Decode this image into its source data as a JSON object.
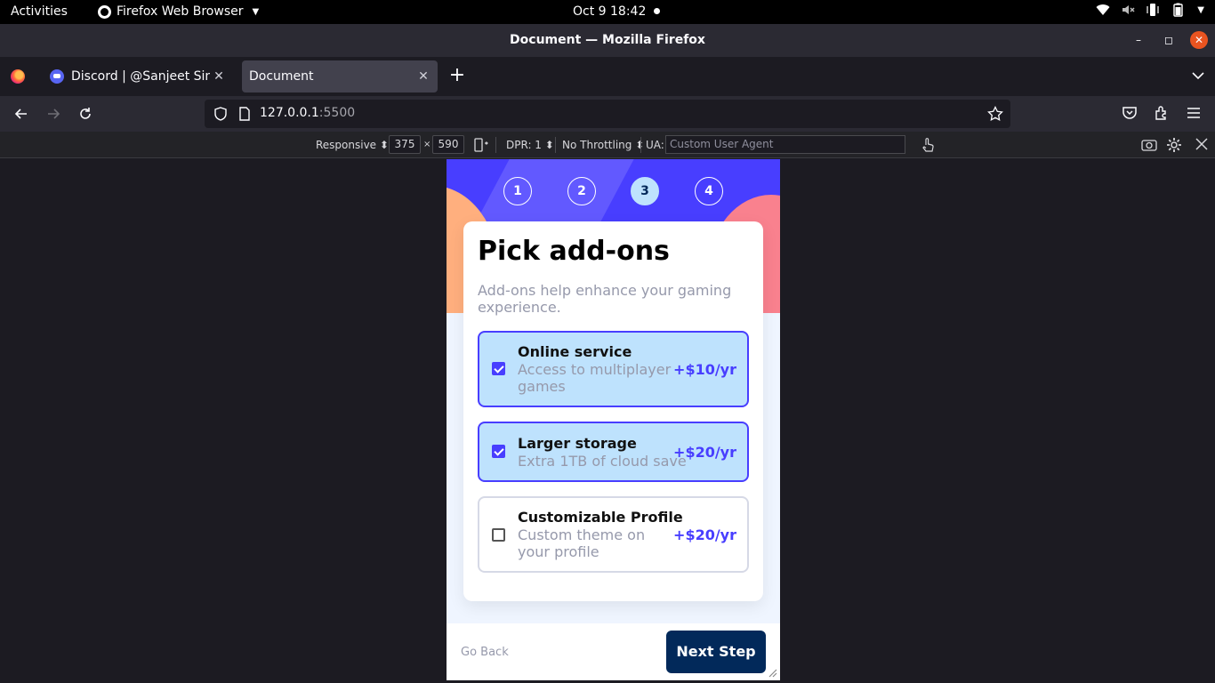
{
  "system": {
    "activities": "Activities",
    "app_name": "Firefox Web Browser",
    "clock": "Oct 9  18:42"
  },
  "window": {
    "title": "Document — Mozilla Firefox"
  },
  "tabs": [
    {
      "label": "Discord | @Sanjeet Singh",
      "active": false
    },
    {
      "label": "Document",
      "active": true
    }
  ],
  "navbar": {
    "url_host": "127.0.0.1",
    "url_port": ":5500"
  },
  "rdm": {
    "device": "Responsive",
    "width": "375",
    "times": "×",
    "height": "590",
    "dpr": "DPR: 1",
    "throttling": "No Throttling",
    "ua_label": "UA:",
    "ua_placeholder": "Custom User Agent"
  },
  "form": {
    "steps": [
      "1",
      "2",
      "3",
      "4"
    ],
    "active_step": 3,
    "title": "Pick add-ons",
    "subtitle": "Add-ons help enhance your gaming experience.",
    "addons": [
      {
        "name": "Online service",
        "description": "Access to multiplayer games",
        "price": "+$10/yr",
        "checked": true
      },
      {
        "name": "Larger storage",
        "description": "Extra 1TB of cloud save",
        "price": "+$20/yr",
        "checked": true
      },
      {
        "name": "Customizable Profile",
        "description": "Custom theme on your profile",
        "price": "+$20/yr",
        "checked": false
      }
    ],
    "back_label": "Go Back",
    "next_label": "Next Step"
  },
  "colors": {
    "accent": "#483eff",
    "marine_blue": "#02295a",
    "light_blue": "#bee2fd",
    "cool_gray": "#9699ab",
    "ubuntu_orange": "#e95420"
  }
}
